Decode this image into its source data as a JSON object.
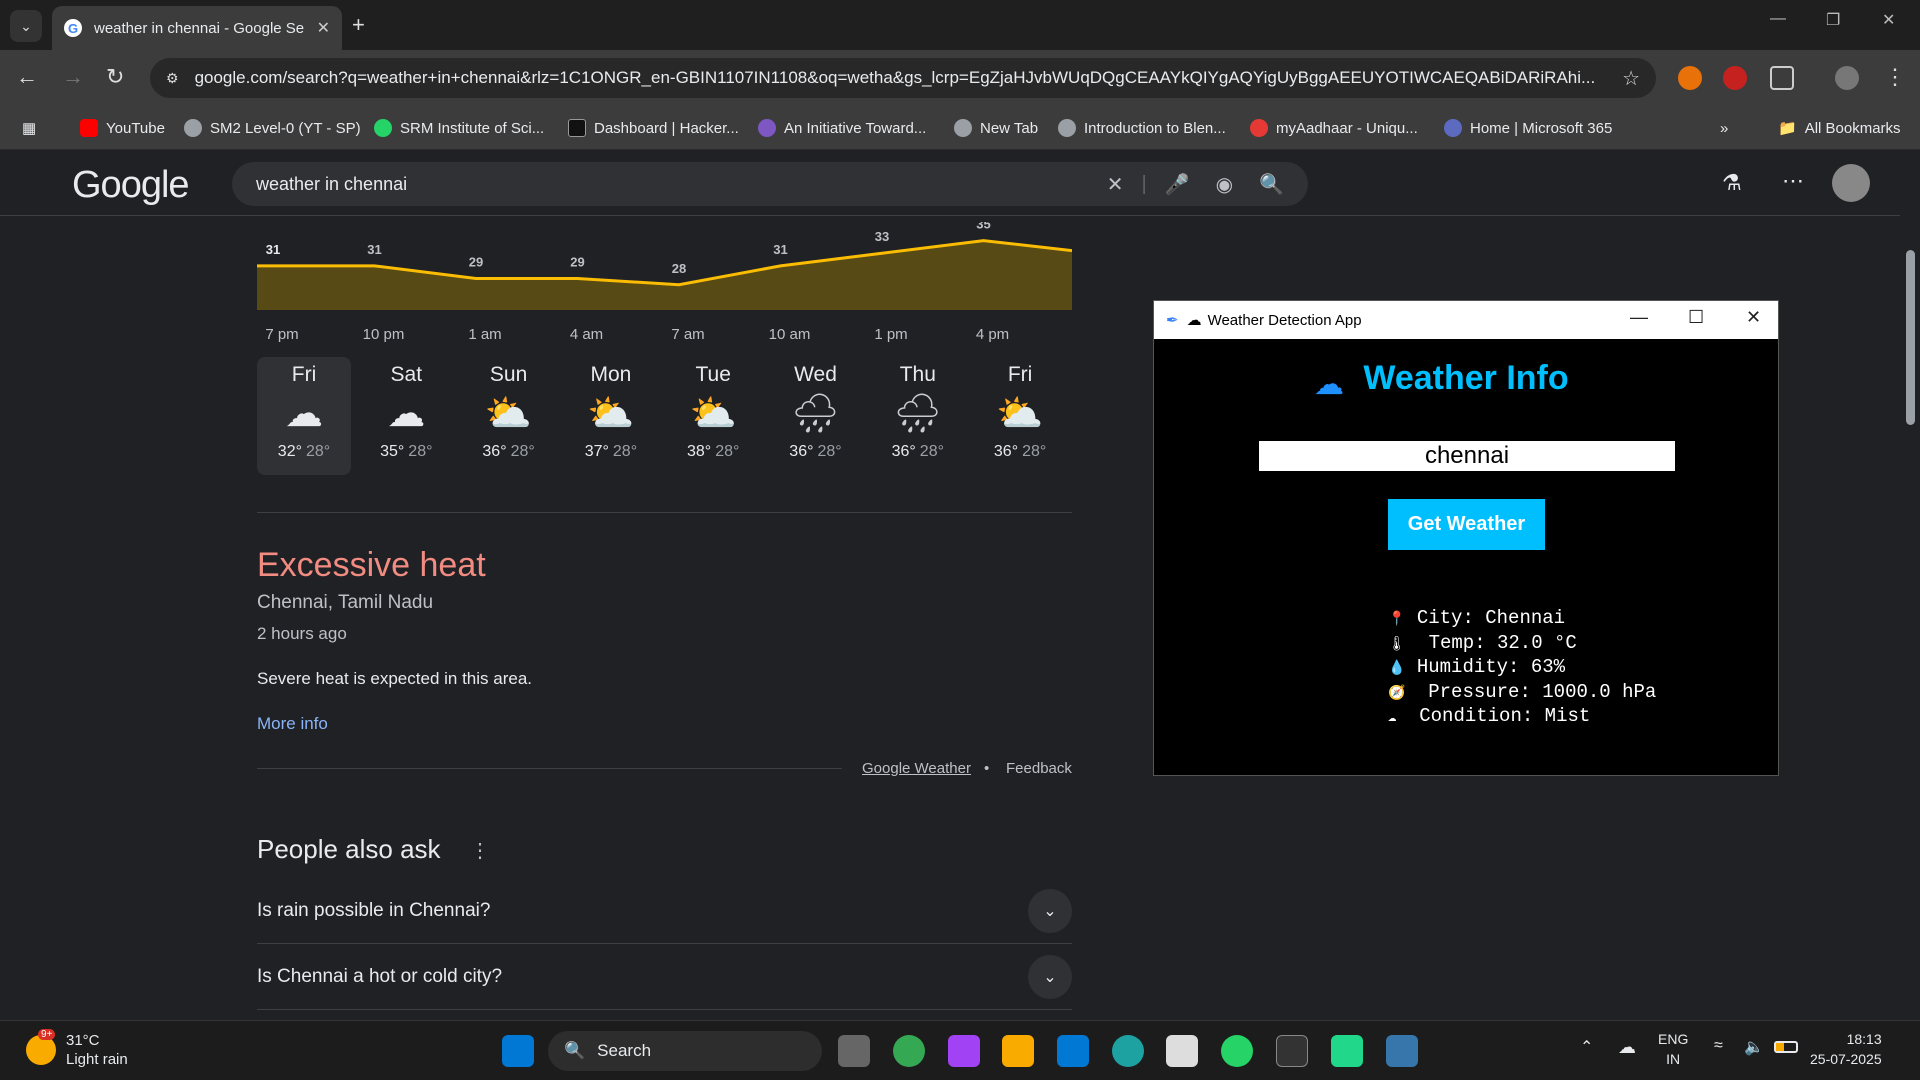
{
  "browser": {
    "tab_title": "weather in chennai - Google Se",
    "url": "google.com/search?q=weather+in+chennai&rlz=1C1ONGR_en-GBIN1107IN1108&oq=wetha&gs_lcrp=EgZjaHJvbWUqDQgCEAAYkQIYgAQYigUyBggAEEUYOTIWCAEQABiDARiRAhi...",
    "bookmarks": [
      "YouTube",
      "SM2 Level-0 (YT - SP)",
      "SRM Institute of Sci...",
      "Dashboard | Hacker...",
      "An Initiative Toward...",
      "New Tab",
      "Introduction to Blen...",
      "myAadhaar - Uniqu...",
      "Home | Microsoft 365"
    ],
    "all_bookmarks": "All Bookmarks"
  },
  "google": {
    "logo": "Google",
    "query": "weather in chennai"
  },
  "hourly": {
    "temps": [
      "31",
      "31",
      "29",
      "29",
      "28",
      "31",
      "33",
      "35"
    ],
    "times": [
      "7 pm",
      "10 pm",
      "1 am",
      "4 am",
      "7 am",
      "10 am",
      "1 pm",
      "4 pm"
    ]
  },
  "forecast": [
    {
      "day": "Fri",
      "icon": "cloudy",
      "hi": "32°",
      "lo": "28°"
    },
    {
      "day": "Sat",
      "icon": "cloudy",
      "hi": "35°",
      "lo": "28°"
    },
    {
      "day": "Sun",
      "icon": "partly-sunny",
      "hi": "36°",
      "lo": "28°"
    },
    {
      "day": "Mon",
      "icon": "partly-sunny",
      "hi": "37°",
      "lo": "28°"
    },
    {
      "day": "Tue",
      "icon": "partly-sunny",
      "hi": "38°",
      "lo": "28°"
    },
    {
      "day": "Wed",
      "icon": "rain",
      "hi": "36°",
      "lo": "28°"
    },
    {
      "day": "Thu",
      "icon": "rain",
      "hi": "36°",
      "lo": "28°"
    },
    {
      "day": "Fri",
      "icon": "partly-sunny",
      "hi": "36°",
      "lo": "28°"
    }
  ],
  "alert": {
    "title": "Excessive heat",
    "location": "Chennai, Tamil Nadu",
    "time": "2 hours ago",
    "description": "Severe heat is expected in this area.",
    "more": "More info"
  },
  "footer": {
    "google_weather": "Google Weather",
    "dot": "•",
    "feedback": "Feedback"
  },
  "paa": {
    "title": "People also ask",
    "questions": [
      "Is rain possible in Chennai?",
      "Is Chennai a hot or cold city?"
    ]
  },
  "app": {
    "window_title": "Weather Detection App",
    "heading": "Weather Info",
    "city_input": "chennai",
    "button": "Get Weather",
    "results": [
      {
        "icon": "📍",
        "text": " City: Chennai"
      },
      {
        "icon": "🌡",
        "text": "  Temp: 32.0 °C"
      },
      {
        "icon": "💧",
        "text": " Humidity: 63%"
      },
      {
        "icon": "🧭",
        "text": "  Pressure: 1000.0 hPa"
      },
      {
        "icon": "☁",
        "text": "  Condition: Mist"
      }
    ]
  },
  "taskbar": {
    "weather_temp": "31°C",
    "weather_desc": "Light rain",
    "weather_badge": "9+",
    "search": "Search",
    "lang_1": "ENG",
    "lang_2": "IN",
    "time": "18:13",
    "date": "25-07-2025"
  },
  "colors": {
    "accent_blue": "#00bfff",
    "alert_red": "#f28b82",
    "link_blue": "#8ab4f8",
    "chart_line": "#fbbc04",
    "chart_fill": "#574a14"
  }
}
